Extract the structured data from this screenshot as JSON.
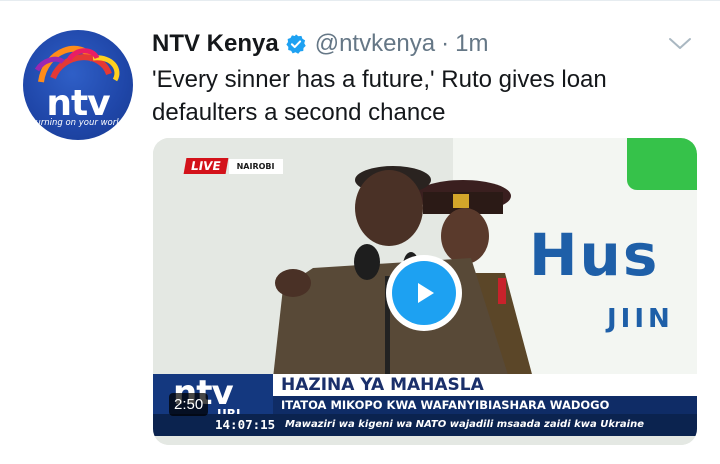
{
  "tweet": {
    "author_name": "NTV Kenya",
    "handle": "@ntvkenya",
    "separator": "·",
    "time": "1m",
    "text": "'Every sinner has a future,' Ruto gives loan defaulters a second chance",
    "verified_icon": "verified-badge-icon",
    "menu_icon": "chevron-down-icon"
  },
  "avatar": {
    "brand": "ntv",
    "slogan": "turning on your world"
  },
  "video": {
    "duration": "2:50",
    "play_icon": "play-icon",
    "live_label": "LIVE",
    "location": "NAIROBI",
    "background_word": "Hus",
    "background_word2": "JIIN",
    "ticker": {
      "logo": "ntv",
      "logo_sub": "URI",
      "headline": "HAZINA YA MAHASLA",
      "subheadline": "ITATOA MIKOPO KWA WAFANYIBIASHARA WADOGO",
      "clock": "14:07:15",
      "crawl": "Mawaziri wa kigeni wa NATO wajadili msaada zaidi kwa Ukraine"
    }
  },
  "colors": {
    "accent": "#1da1f2",
    "secondary_text": "#657786",
    "primary_text": "#14171a",
    "live_red": "#d3121a",
    "ntv_blue": "#14387f"
  }
}
